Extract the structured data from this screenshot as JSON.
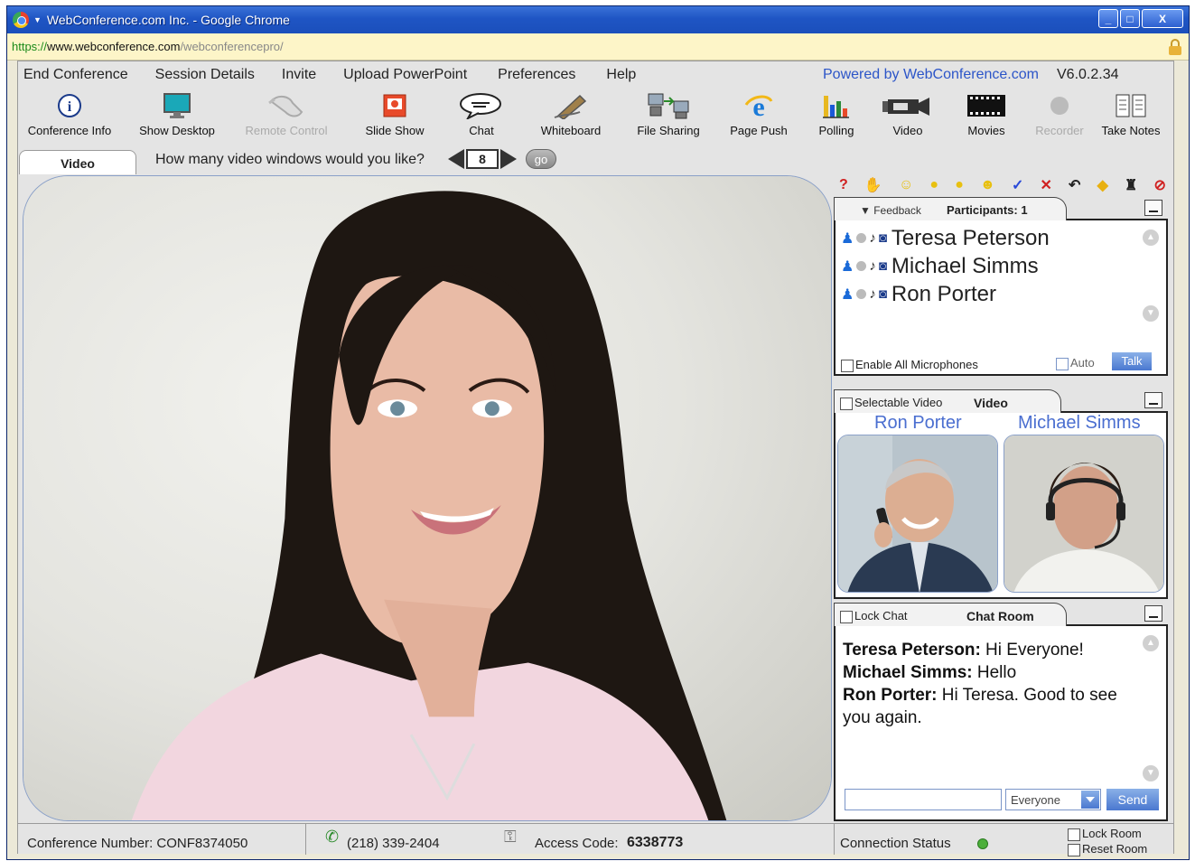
{
  "window": {
    "title": "WebConference.com Inc. - Google Chrome",
    "url_scheme": "https://",
    "url_host": "www.webconference.com",
    "url_path": "/webconferencepro/",
    "buttons": [
      "minimize",
      "maximize",
      "close"
    ]
  },
  "menu": {
    "items": [
      "End Conference",
      "Session Details",
      "Invite",
      "Upload PowerPoint",
      "Preferences",
      "Help"
    ],
    "powered_by": "Powered by WebConference.com",
    "version": "V6.0.2.34"
  },
  "toolbar": {
    "items": [
      {
        "label": "Conference Info",
        "icon": "info-icon",
        "enabled": true
      },
      {
        "label": "Show Desktop",
        "icon": "monitor-icon",
        "enabled": true
      },
      {
        "label": "Remote Control",
        "icon": "mouse-icon",
        "enabled": false
      },
      {
        "label": "Slide Show",
        "icon": "powerpoint-icon",
        "enabled": true
      },
      {
        "label": "Chat",
        "icon": "speech-bubble-icon",
        "enabled": true
      },
      {
        "label": "Whiteboard",
        "icon": "pencil-icon",
        "enabled": true
      },
      {
        "label": "File Sharing",
        "icon": "computers-icon",
        "enabled": true
      },
      {
        "label": "Page Push",
        "icon": "browser-e-icon",
        "enabled": true
      },
      {
        "label": "Polling",
        "icon": "bar-chart-icon",
        "enabled": true
      },
      {
        "label": "Video",
        "icon": "video-camera-icon",
        "enabled": true
      },
      {
        "label": "Movies",
        "icon": "film-strip-icon",
        "enabled": true
      },
      {
        "label": "Recorder",
        "icon": "record-dot-icon",
        "enabled": false
      },
      {
        "label": "Take Notes",
        "icon": "notes-icon",
        "enabled": true
      }
    ]
  },
  "video_tab": {
    "tab_label": "Video",
    "question": "How many video windows would you like?",
    "count": "8",
    "go_label": "go"
  },
  "feedback_icons": [
    "question-icon",
    "hand-raise-icon",
    "smile-icon",
    "neutral-face-icon",
    "surprised-face-icon",
    "laugh-face-icon",
    "check-icon",
    "x-icon",
    "undo-icon",
    "diamond-icon",
    "users-icon",
    "block-icon"
  ],
  "participants_panel": {
    "feedback_label": "Feedback",
    "title": "Participants: 1",
    "names": [
      "Teresa Peterson",
      "Michael Simms",
      "Ron Porter"
    ],
    "enable_all_mics": "Enable All Microphones",
    "auto_label": "Auto",
    "talk_label": "Talk"
  },
  "video_panel": {
    "selectable_label": "Selectable Video",
    "title": "Video",
    "thumb1_name": "Ron Porter",
    "thumb2_name": "Michael Simms"
  },
  "chat_panel": {
    "lock_label": "Lock Chat",
    "title": "Chat Room",
    "messages": [
      {
        "sender": "Teresa Peterson:",
        "text": " Hi Everyone!"
      },
      {
        "sender": "Michael Simms:",
        "text": " Hello"
      },
      {
        "sender": "Ron Porter:",
        "text": " Hi Teresa. Good to see you again."
      }
    ],
    "input_value": "",
    "recipient": "Everyone",
    "send_label": "Send"
  },
  "status": {
    "conference_number": "Conference Number: CONF8374050",
    "phone": "(218) 339-2404",
    "access_code_label": "Access Code:",
    "access_code": "6338773",
    "connection_label": "Connection Status",
    "connection_color": "#4caf3a",
    "lock_room": "Lock Room",
    "reset_room": "Reset Room"
  }
}
